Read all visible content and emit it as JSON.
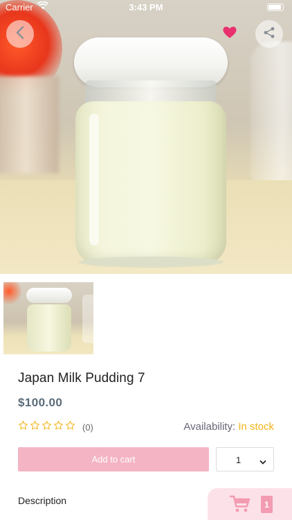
{
  "status_bar": {
    "carrier": "Carrier",
    "time": "3:43 PM"
  },
  "header": {
    "back_icon": "chevron-left-icon",
    "favorite_icon": "heart-icon",
    "favorite_color": "#e8316e",
    "share_icon": "share-icon"
  },
  "product": {
    "title": "Japan Milk Pudding 7",
    "price": "$100.00",
    "rating_stars": 0,
    "rating_max": 5,
    "review_count": "(0)",
    "availability_label": "Availability: ",
    "availability_value": "In stock",
    "availability_color": "#f2b418"
  },
  "actions": {
    "add_to_cart_label": "Add to cart",
    "add_to_cart_color": "#f4b4c4",
    "quantity_value": "1"
  },
  "sections": {
    "description_label": "Description"
  },
  "cart": {
    "count": "1",
    "accent_color": "#f29bb1"
  }
}
